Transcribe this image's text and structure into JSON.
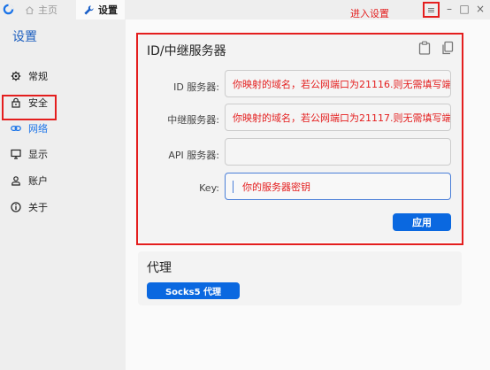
{
  "titlebar": {
    "home_tab": "主页",
    "settings_tab": "设置",
    "annotation": "进入设置",
    "menu_icon": "≡",
    "minimize": "–",
    "maximize": "□",
    "close": "×"
  },
  "sidebar": {
    "title": "设置",
    "items": [
      {
        "label": "常规",
        "icon": "gear-icon"
      },
      {
        "label": "安全",
        "icon": "lock-icon"
      },
      {
        "label": "网络",
        "icon": "link-icon"
      },
      {
        "label": "显示",
        "icon": "monitor-icon"
      },
      {
        "label": "账户",
        "icon": "user-icon"
      },
      {
        "label": "关于",
        "icon": "info-icon"
      }
    ]
  },
  "server_card": {
    "title": "ID/中继服务器",
    "fields": [
      {
        "label": "ID 服务器:",
        "value": "你映射的域名，若公网端口为21116.则无需填写端口"
      },
      {
        "label": "中继服务器:",
        "value": "你映射的域名，若公网端口为21117.则无需填写端口"
      },
      {
        "label": "API 服务器:",
        "value": ""
      },
      {
        "label": "Key:",
        "value": "你的服务器密钥"
      }
    ],
    "apply_label": "应用"
  },
  "proxy_card": {
    "title": "代理",
    "socks_label": "Socks5 代理"
  },
  "colors": {
    "accent": "#0a68e0",
    "annotation": "#e41e1e",
    "sidebar_title": "#1d5fbf"
  }
}
